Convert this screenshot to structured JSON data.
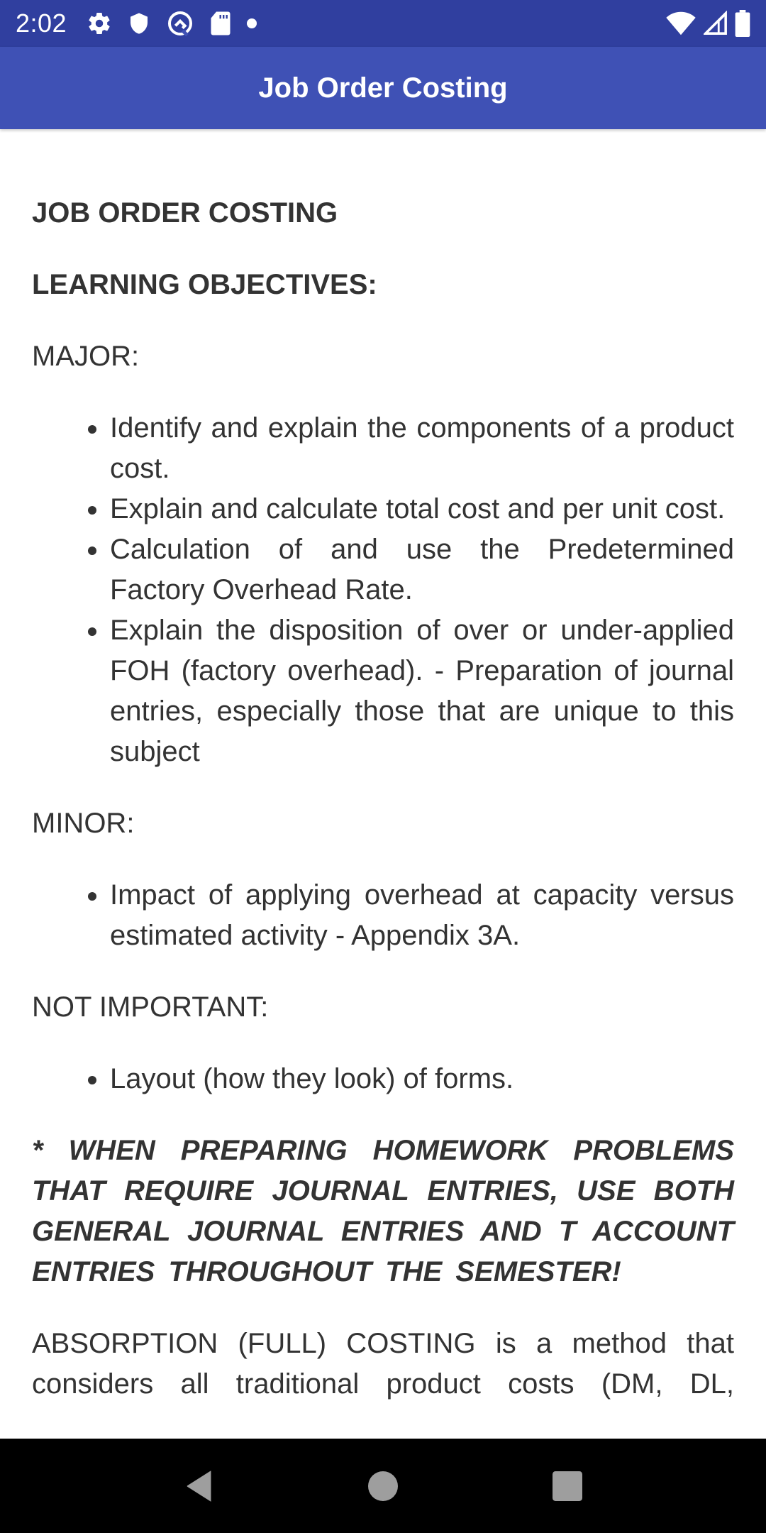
{
  "status_bar": {
    "time": "2:02",
    "left_icons": [
      "settings-icon",
      "shield-icon",
      "sync-q-icon",
      "sd-card-icon",
      "notification-dot-icon"
    ],
    "right_icons": [
      "wifi-icon",
      "cellular-signal-icon",
      "battery-icon"
    ]
  },
  "app_bar": {
    "title": "Job Order Costing"
  },
  "content": {
    "title": "JOB ORDER COSTING",
    "objectives_heading": "LEARNING OBJECTIVES:",
    "major": {
      "label": "MAJOR:",
      "items": [
        "Identify and explain the components of a product cost.",
        "Explain and calculate total cost and per unit cost.",
        "Calculation of and use the Predetermined Factory Overhead Rate.",
        "Explain the disposition of over or under-applied FOH (factory overhead). - Preparation of journal entries, especially those that are unique to this subject"
      ]
    },
    "minor": {
      "label": "MINOR:",
      "items": [
        "Impact of applying overhead at capacity versus estimated activity - Appendix 3A."
      ]
    },
    "not_important": {
      "label": "NOT IMPORTANT:",
      "items": [
        "Layout (how they look) of forms."
      ]
    },
    "note": "* WHEN PREPARING HOMEWORK PROBLEMS THAT REQUIRE JOURNAL ENTRIES, USE BOTH GENERAL JOURNAL ENTRIES AND T ACCOUNT ENTRIES THROUGHOUT THE SEMESTER!",
    "absorption_paragraph": "ABSORPTION (FULL) COSTING is a method that considers all traditional product costs (DM, DL,"
  },
  "nav_bar": {
    "buttons": [
      "back",
      "home",
      "recents"
    ]
  },
  "colors": {
    "status_bar": "#303F9F",
    "app_bar": "#3F51B5",
    "text": "#333333",
    "nav_bar": "#000000",
    "nav_icons": "#9E9E9E"
  }
}
